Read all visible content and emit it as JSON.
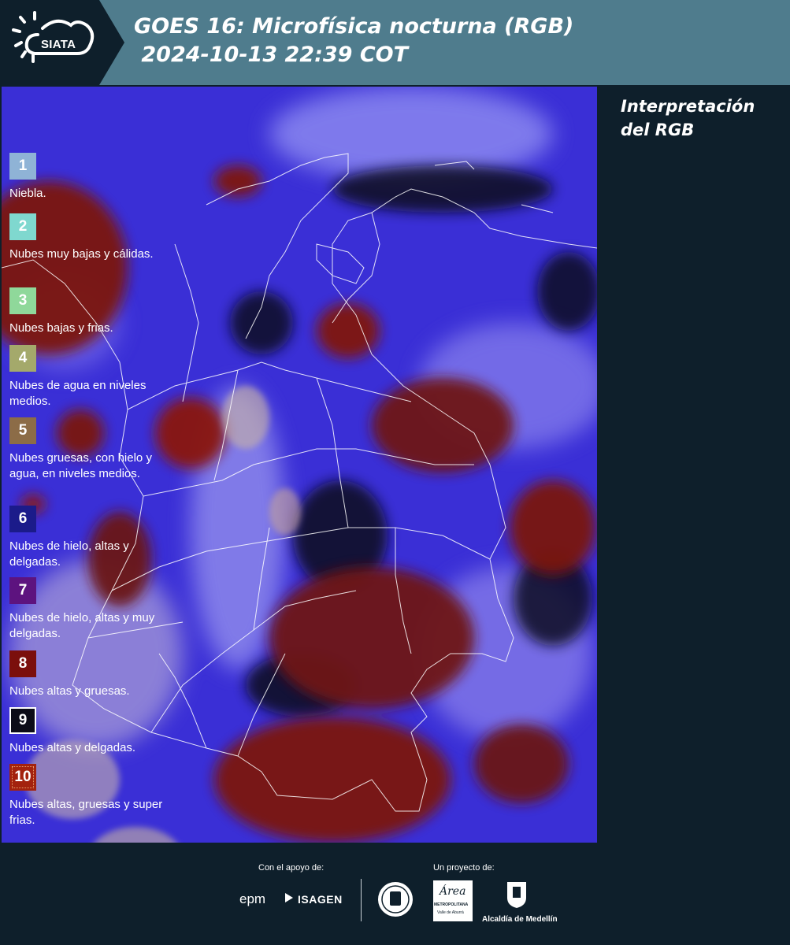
{
  "header": {
    "logo_text": "SIATA",
    "title_line1": "GOES 16: Microfísica nocturna (RGB)",
    "title_line2": " 2024-10-13 22:39 COT"
  },
  "legend": {
    "title": "Interpretación del RGB",
    "items": [
      {
        "number": "1",
        "label": "Niebla.",
        "color": "#8fb3d6"
      },
      {
        "number": "2",
        "label": "Nubes muy bajas y cálidas.",
        "color": "#7fd8cf"
      },
      {
        "number": "3",
        "label": "Nubes bajas y frias.",
        "color": "#8fd89a"
      },
      {
        "number": "4",
        "label": "Nubes de agua en niveles medios.",
        "color": "#a4a96b"
      },
      {
        "number": "5",
        "label": "Nubes gruesas, con hielo y agua, en niveles medios.",
        "color": "#8c6c47"
      },
      {
        "number": "6",
        "label": "Nubes de hielo, altas y delgadas.",
        "color": "#1b1b8a"
      },
      {
        "number": "7",
        "label": "Nubes de hielo, altas y muy delgadas.",
        "color": "#5d137f"
      },
      {
        "number": "8",
        "label": "Nubes altas y gruesas.",
        "color": "#7b0f0c"
      },
      {
        "number": "9",
        "label": "Nubes altas y delgadas.",
        "color": "#0c0c18"
      },
      {
        "number": "10",
        "label": "Nubes altas, gruesas y super frias.",
        "color": "#a3220e"
      }
    ]
  },
  "footer": {
    "support_label": "Con el apoyo de:",
    "project_label": "Un proyecto de:",
    "logo_epm": "epm",
    "logo_isagen": "ISAGEN",
    "logo_area": "Área",
    "logo_area_sub": "METROPOLITANA",
    "logo_area_sub2": "Valle de Aburrá",
    "logo_medellin": "Alcaldía de Medellín"
  }
}
